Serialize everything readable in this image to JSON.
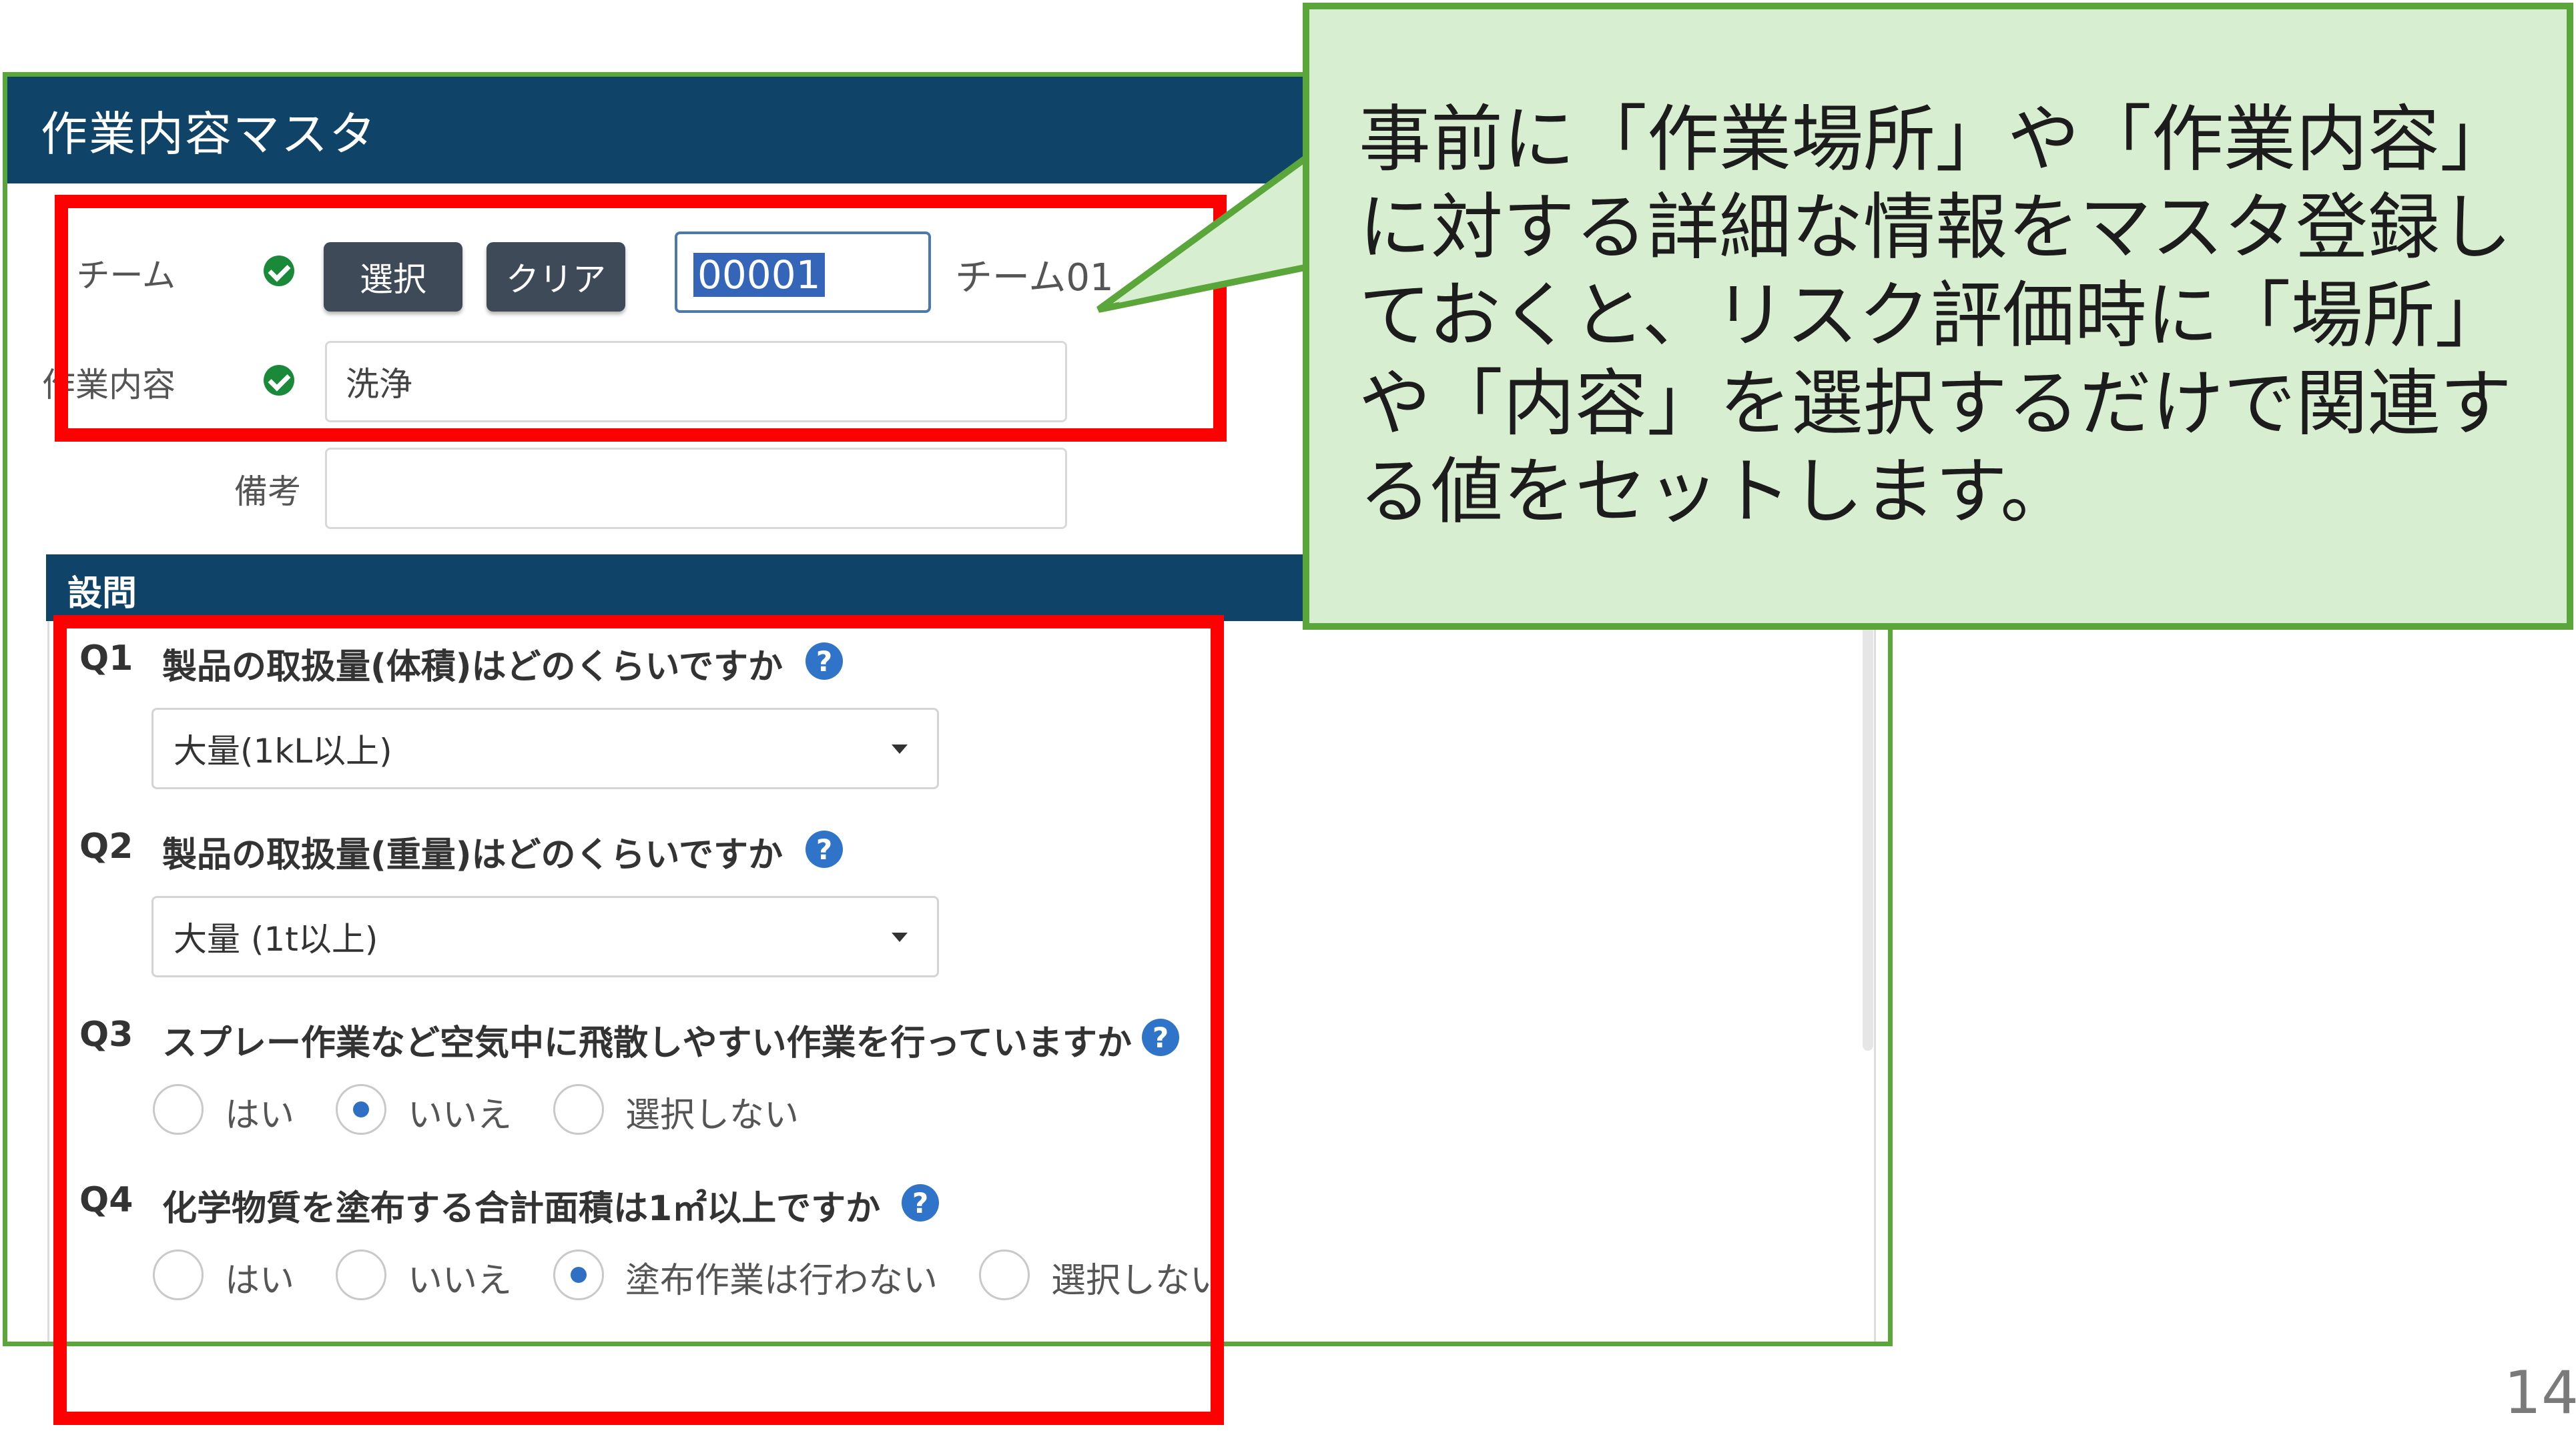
{
  "window": {
    "title": "作業内容マスタ"
  },
  "form": {
    "team_label": "チーム",
    "select_button": "選択",
    "clear_button": "クリア",
    "team_code": "00001",
    "team_name": "チーム01",
    "task_label": "作業内容",
    "task_value": "洗浄",
    "remarks_label": "備考",
    "remarks_value": ""
  },
  "section": {
    "title": "設問"
  },
  "questions": [
    {
      "no": "Q1",
      "text": "製品の取扱量(体積)はどのくらいですか",
      "selected": "大量(1kL以上)"
    },
    {
      "no": "Q2",
      "text": "製品の取扱量(重量)はどのくらいですか",
      "selected": "大量 (1t以上)"
    },
    {
      "no": "Q3",
      "text": "スプレー作業など空気中に飛散しやすい作業を行っていますか",
      "options": [
        "はい",
        "いいえ",
        "選択しない"
      ],
      "checked_index": 1
    },
    {
      "no": "Q4",
      "text": "化学物質を塗布する合計面積は1㎡以上ですか",
      "options": [
        "はい",
        "いいえ",
        "塗布作業は行わない",
        "選択しない"
      ],
      "checked_index": 2
    }
  ],
  "callout": {
    "text": "事前に「作業場所」や「作業内容」に対する詳細な情報をマスタ登録しておくと、リスク評価時に「場所」や「内容」を選択するだけで関連する値をセットします。"
  },
  "page_number": "14",
  "colors": {
    "header_bg": "#0f4468",
    "highlight_border": "#ff0000",
    "callout_bg": "#d8eed0",
    "callout_border": "#5aa63a",
    "radio_checked": "#2f6fc4",
    "help_icon": "#2f74c8"
  }
}
